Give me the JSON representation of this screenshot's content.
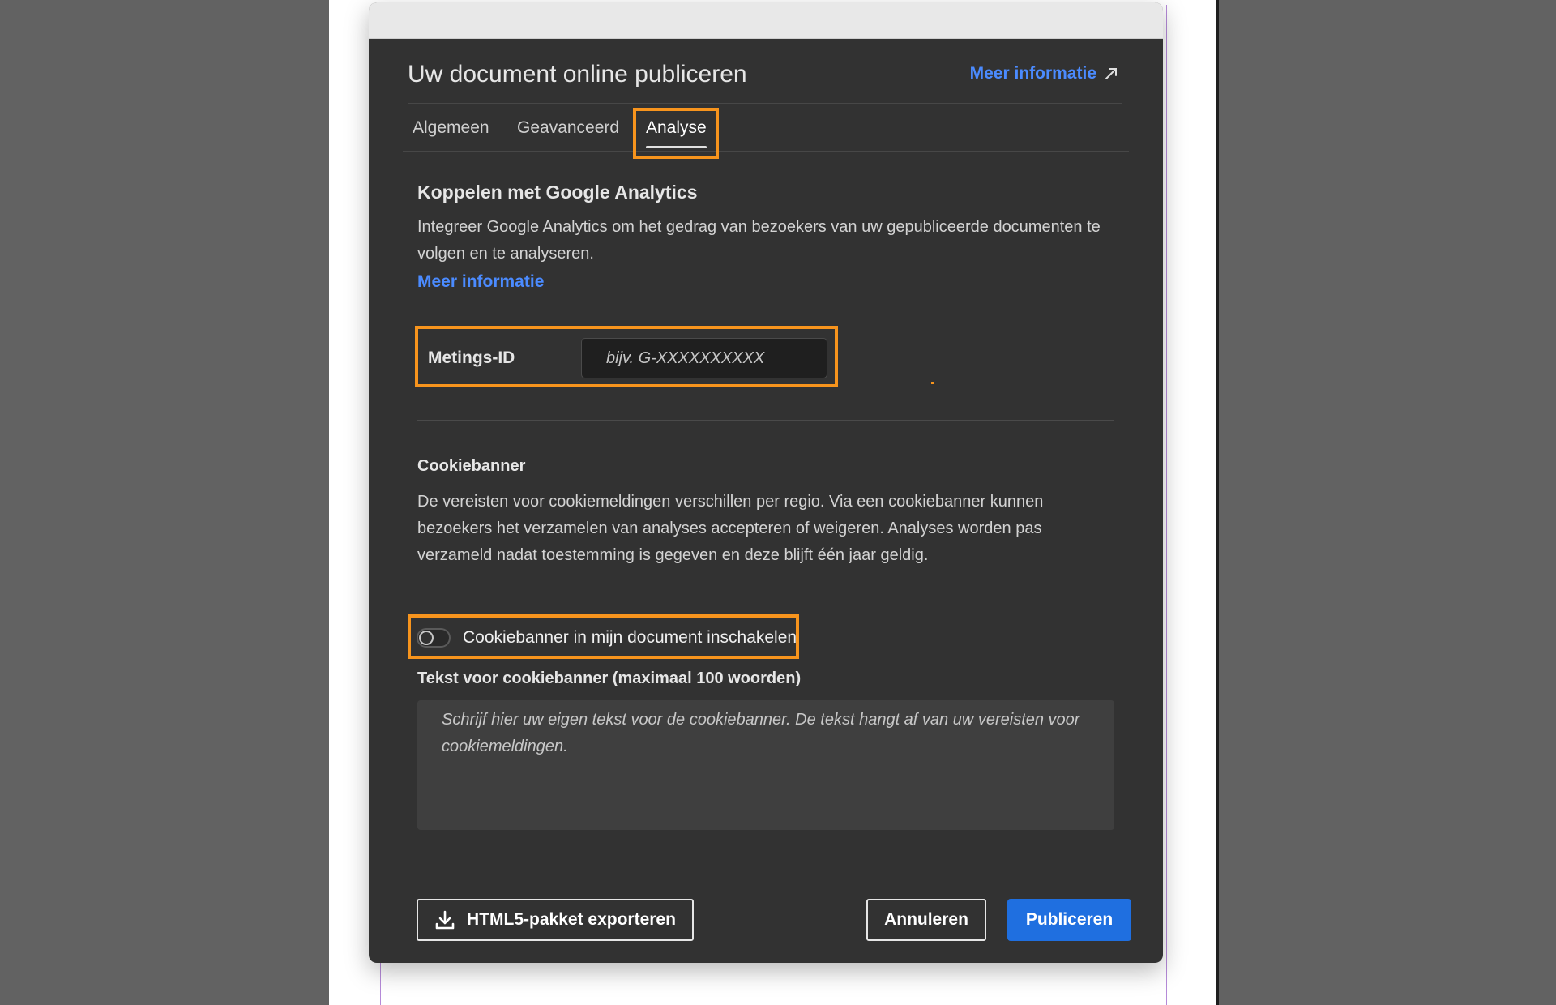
{
  "dialog": {
    "title": "Uw document online publiceren",
    "help_link": "Meer informatie",
    "help_link_icon": "external-arrow-icon"
  },
  "tabs": [
    {
      "label": "Algemeen",
      "active": false
    },
    {
      "label": "Geavanceerd",
      "active": false
    },
    {
      "label": "Analyse",
      "active": true
    }
  ],
  "analytics": {
    "heading": "Koppelen met Google Analytics",
    "description": "Integreer Google Analytics om het gedrag van bezoekers van uw gepubliceerde documenten te volgen en te analyseren.",
    "link": "Meer informatie",
    "measurement_label": "Metings-ID",
    "measurement_value": "",
    "measurement_placeholder": "bijv. G-XXXXXXXXXX"
  },
  "cookie": {
    "heading": "Cookiebanner",
    "description": "De vereisten voor cookiemeldingen verschillen per regio. Via een cookiebanner kunnen bezoekers het verzamelen van analyses accepteren of weigeren. Analyses worden pas verzameld nadat toestemming is gegeven en deze blijft één jaar geldig.",
    "toggle_label": "Cookiebanner in mijn document inschakelen",
    "toggle_on": false,
    "text_label": "Tekst voor cookiebanner (maximaal 100 woorden)",
    "text_value": "",
    "text_placeholder": "Schrijf hier uw eigen tekst voor de cookiebanner. De tekst hangt af van uw vereisten voor cookiemeldingen."
  },
  "footer": {
    "export_label": "HTML5-pakket exporteren",
    "export_icon": "download-icon",
    "cancel_label": "Annuleren",
    "publish_label": "Publiceren"
  },
  "colors": {
    "highlight": "#f7941d",
    "link": "#4b8bff",
    "primary": "#1f6fe0",
    "dialog_bg": "#323232"
  }
}
